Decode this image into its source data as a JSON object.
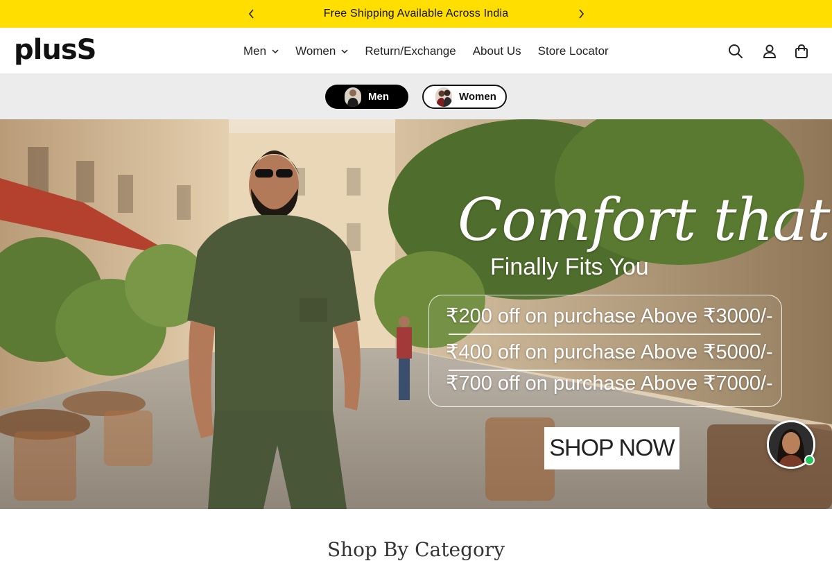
{
  "announcement": {
    "message": "Free Shipping Available Across India",
    "prev_icon": "chevron-left-icon",
    "next_icon": "chevron-right-icon"
  },
  "header": {
    "logo": "plusS",
    "nav": [
      {
        "label": "Men",
        "dropdown": true
      },
      {
        "label": "Women",
        "dropdown": true
      },
      {
        "label": "Return/Exchange",
        "dropdown": false
      },
      {
        "label": "About Us",
        "dropdown": false
      },
      {
        "label": "Store Locator",
        "dropdown": false
      }
    ],
    "icons": [
      "search-icon",
      "account-icon",
      "shopping-bag-icon"
    ]
  },
  "gender_switch": {
    "men_label": "Men",
    "women_label": "Women",
    "active": "Men"
  },
  "hero": {
    "title": "Comfort that",
    "subtitle": "Finally Fits You",
    "offers": [
      "₹200 off on purchase Above ₹3000/-",
      "₹400 off on purchase Above ₹5000/-",
      "₹700 off on purchase Above ₹7000/-"
    ],
    "cta": "SHOP NOW"
  },
  "chat": {
    "status_color": "#22c55e"
  },
  "next_section": {
    "title": "Shop By Category"
  },
  "colors": {
    "announcement_bg": "#ffde00",
    "active_pill": "#000000"
  }
}
